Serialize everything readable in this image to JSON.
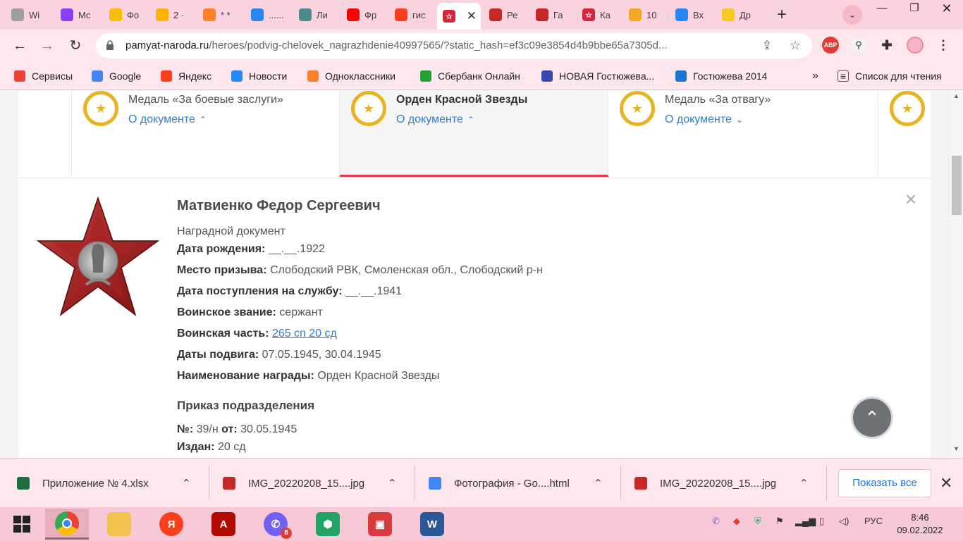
{
  "tabs": [
    {
      "label": "Wi",
      "icon": "chrome-icon",
      "color": "#9e9e9e"
    },
    {
      "label": "Mc",
      "icon": "yoomoney-icon",
      "color": "#8b3ffd"
    },
    {
      "label": "Фо",
      "icon": "google-photos-icon",
      "color": "#fbbc04"
    },
    {
      "label": "2 ·",
      "icon": "mail-icon",
      "color": "#ffb300"
    },
    {
      "label": "* *",
      "icon": "mail-ru-icon",
      "color": "#ff7f2a"
    },
    {
      "label": "......",
      "icon": "vk-icon",
      "color": "#2787f5"
    },
    {
      "label": "Ли",
      "icon": "wheel-icon",
      "color": "#4b8b8b"
    },
    {
      "label": "Фр",
      "icon": "youtube-icon",
      "color": "#ff0000"
    },
    {
      "label": "гис",
      "icon": "yandex-icon",
      "color": "#fc3f1d"
    },
    {
      "label": "",
      "icon": "star-icon",
      "color": "#d6253a",
      "active": true
    },
    {
      "label": "Ре",
      "icon": "medal-icon",
      "color": "#c62828"
    },
    {
      "label": "Га",
      "icon": "medal-icon",
      "color": "#c62828"
    },
    {
      "label": "Ка",
      "icon": "star-icon",
      "color": "#d6253a"
    },
    {
      "label": "10",
      "icon": "photo-icon",
      "color": "#f5a623"
    },
    {
      "label": "Вх",
      "icon": "vk-icon",
      "color": "#2787f5"
    },
    {
      "label": "Др",
      "icon": "sun-icon",
      "color": "#f9c923"
    }
  ],
  "toolbar": {
    "url_host": "pamyat-naroda.ru",
    "url_path": "/heroes/podvig-chelovek_nagrazhdenie40997565/?static_hash=ef3c09e3854d4b9bbe65a7305d...",
    "abp_label": "ABP"
  },
  "bookmarks": [
    {
      "label": "Сервисы",
      "icon": "apps-icon",
      "color": "#ea4335"
    },
    {
      "label": "Google",
      "icon": "google-icon",
      "color": "#4285f4"
    },
    {
      "label": "Яндекс",
      "icon": "yandex-icon",
      "color": "#fc3f1d"
    },
    {
      "label": "Новости",
      "icon": "vk-icon",
      "color": "#2787f5"
    },
    {
      "label": "Одноклассники",
      "icon": "mail-icon",
      "color": "#ff7f2a"
    },
    {
      "label": "Сбербанк Онлайн",
      "icon": "sber-icon",
      "color": "#21a038"
    },
    {
      "label": "НОВАЯ Гостюжева...",
      "icon": "bookmark-doc-icon",
      "color": "#3949ab"
    },
    {
      "label": "Гостюжева 2014",
      "icon": "bookmark-doc-icon",
      "color": "#1976d2"
    }
  ],
  "bookmarks_more": "»",
  "reading_list": "Список для чтения",
  "awards": [
    {
      "name": "Медаль «За боевые заслуги»",
      "doc": "О документе",
      "chev": "⌃"
    },
    {
      "name": "Орден Красной Звезды",
      "doc": "О документе",
      "chev": "⌃",
      "selected": true
    },
    {
      "name": "Медаль «За отвагу»",
      "doc": "О документе",
      "chev": "⌄"
    }
  ],
  "person": {
    "name": "Матвиенко Федор Сергеевич",
    "doc_type": "Наградной документ",
    "fields": [
      {
        "label": "Дата рождения:",
        "value": "__.__.1922"
      },
      {
        "label": "Место призыва:",
        "value": "Слободский РВК, Смоленская обл., Слободский р-н"
      },
      {
        "label": "Дата поступления на службу:",
        "value": "__.__.1941"
      },
      {
        "label": "Воинское звание:",
        "value": "сержант"
      },
      {
        "label": "Воинская часть:",
        "value": "265 сп 20 сд",
        "link": true
      },
      {
        "label": "Даты подвига:",
        "value": "07.05.1945, 30.04.1945"
      },
      {
        "label": "Наименование награды:",
        "value": "Орден Красной Звезды"
      }
    ]
  },
  "order": {
    "title": "Приказ подразделения",
    "number_label": "№:",
    "number": "39/н",
    "from_label": "от:",
    "date": "30.05.1945",
    "issued_label": "Издан:",
    "issued": "20 сд"
  },
  "downloads": [
    {
      "name": "Приложение № 4.xlsx",
      "icon": "excel-file-icon",
      "color": "#1d6f42"
    },
    {
      "name": "IMG_20220208_15....jpg",
      "icon": "image-file-icon",
      "color": "#c62828"
    },
    {
      "name": "Фотография - Go....html",
      "icon": "chrome-icon",
      "color": "#4285f4"
    },
    {
      "name": "IMG_20220208_15....jpg",
      "icon": "image-file-icon",
      "color": "#c62828"
    }
  ],
  "downloads_show_all": "Показать все",
  "taskbar": {
    "viber_badge": "8",
    "lang": "РУС",
    "time": "8:46",
    "date": "09.02.2022"
  }
}
